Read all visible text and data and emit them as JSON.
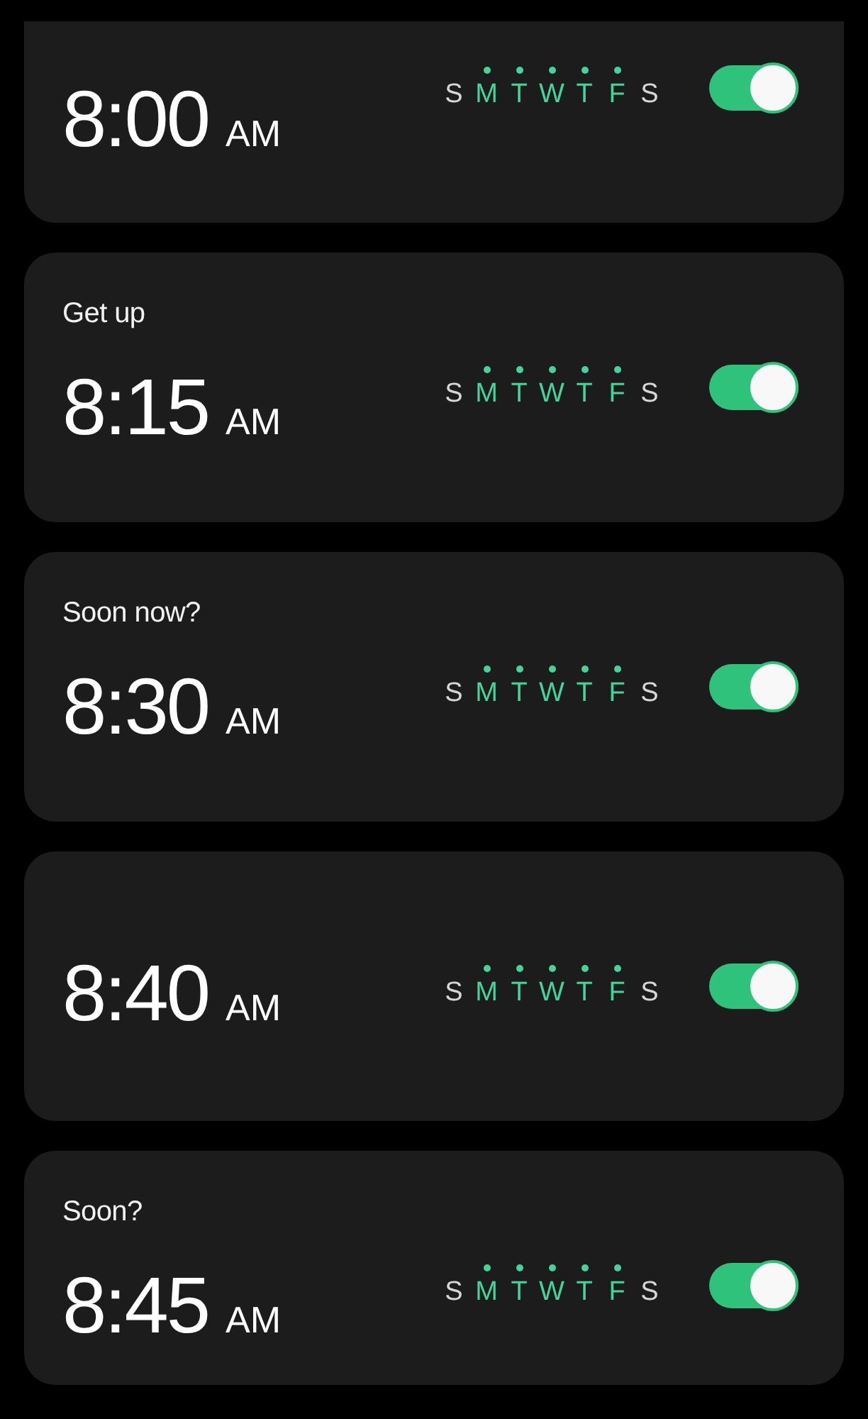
{
  "alarms": [
    {
      "time": "8:00",
      "period": "AM",
      "days": [
        {
          "letter": "S",
          "active": false
        },
        {
          "letter": "M",
          "active": true
        },
        {
          "letter": "T",
          "active": true
        },
        {
          "letter": "W",
          "active": true
        },
        {
          "letter": "T",
          "active": true
        },
        {
          "letter": "F",
          "active": true
        },
        {
          "letter": "S",
          "active": false
        }
      ],
      "on": true
    },
    {
      "label": "Get up",
      "time": "8:15",
      "period": "AM",
      "days": [
        {
          "letter": "S",
          "active": false
        },
        {
          "letter": "M",
          "active": true
        },
        {
          "letter": "T",
          "active": true
        },
        {
          "letter": "W",
          "active": true
        },
        {
          "letter": "T",
          "active": true
        },
        {
          "letter": "F",
          "active": true
        },
        {
          "letter": "S",
          "active": false
        }
      ],
      "on": true
    },
    {
      "label": "Soon now?",
      "time": "8:30",
      "period": "AM",
      "days": [
        {
          "letter": "S",
          "active": false
        },
        {
          "letter": "M",
          "active": true
        },
        {
          "letter": "T",
          "active": true
        },
        {
          "letter": "W",
          "active": true
        },
        {
          "letter": "T",
          "active": true
        },
        {
          "letter": "F",
          "active": true
        },
        {
          "letter": "S",
          "active": false
        }
      ],
      "on": true
    },
    {
      "time": "8:40",
      "period": "AM",
      "days": [
        {
          "letter": "S",
          "active": false
        },
        {
          "letter": "M",
          "active": true
        },
        {
          "letter": "T",
          "active": true
        },
        {
          "letter": "W",
          "active": true
        },
        {
          "letter": "T",
          "active": true
        },
        {
          "letter": "F",
          "active": true
        },
        {
          "letter": "S",
          "active": false
        }
      ],
      "on": true
    },
    {
      "label": "Soon?",
      "time": "8:45",
      "period": "AM",
      "days": [
        {
          "letter": "S",
          "active": false
        },
        {
          "letter": "M",
          "active": true
        },
        {
          "letter": "T",
          "active": true
        },
        {
          "letter": "W",
          "active": true
        },
        {
          "letter": "T",
          "active": true
        },
        {
          "letter": "F",
          "active": true
        },
        {
          "letter": "S",
          "active": false
        }
      ],
      "on": true
    }
  ]
}
